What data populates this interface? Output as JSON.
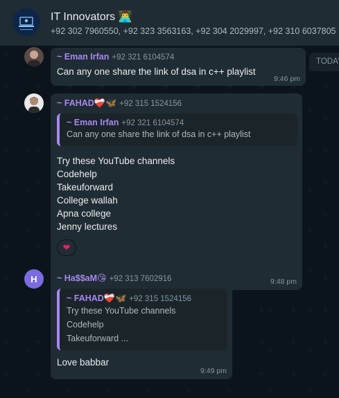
{
  "header": {
    "title": "IT Innovators 👨‍💻",
    "members": "+92 302 7960550, +92 323 3563163, +92 304 2029997, +92 310 6037805"
  },
  "date_chip": "TODAY",
  "messages": [
    {
      "sender": "~ Eman Irfan",
      "phone": "+92 321 6104574",
      "text": "Can any one share the link of dsa in c++  playlist",
      "time": "9:46 pm"
    },
    {
      "sender": "~ FAHAD",
      "sender_emoji": "❤️‍🩹🦋",
      "phone": "+92 315 1524156",
      "quote_sender": "~ Eman Irfan",
      "quote_phone": "+92 321 6104574",
      "quote_text": "Can any one share the link of dsa in c++  playlist",
      "text": "Try these YouTube channels\nCodehelp\nTakeuforward\nCollege wallah\nApna college\nJenny lectures",
      "time": "9:48 pm",
      "reaction": "❤"
    },
    {
      "avatar_letter": "H",
      "sender": "~ Ha$$aM",
      "sender_emoji": "😘",
      "phone": "+92 313 7602916",
      "quote_sender": "~ FAHAD",
      "quote_sender_emoji": "❤️‍🩹🦋",
      "quote_phone": "+92 315 1524156",
      "quote_text": "Try these YouTube channels\nCodehelp\nTakeuforward ...",
      "text": "Love babbar",
      "time": "9:49 pm"
    }
  ],
  "colors": {
    "background": "#0b141a",
    "header": "#202c33",
    "bubble": "#202c33",
    "quote": "#1a2429",
    "accent": "#a887f0",
    "meta": "#8696a0"
  }
}
